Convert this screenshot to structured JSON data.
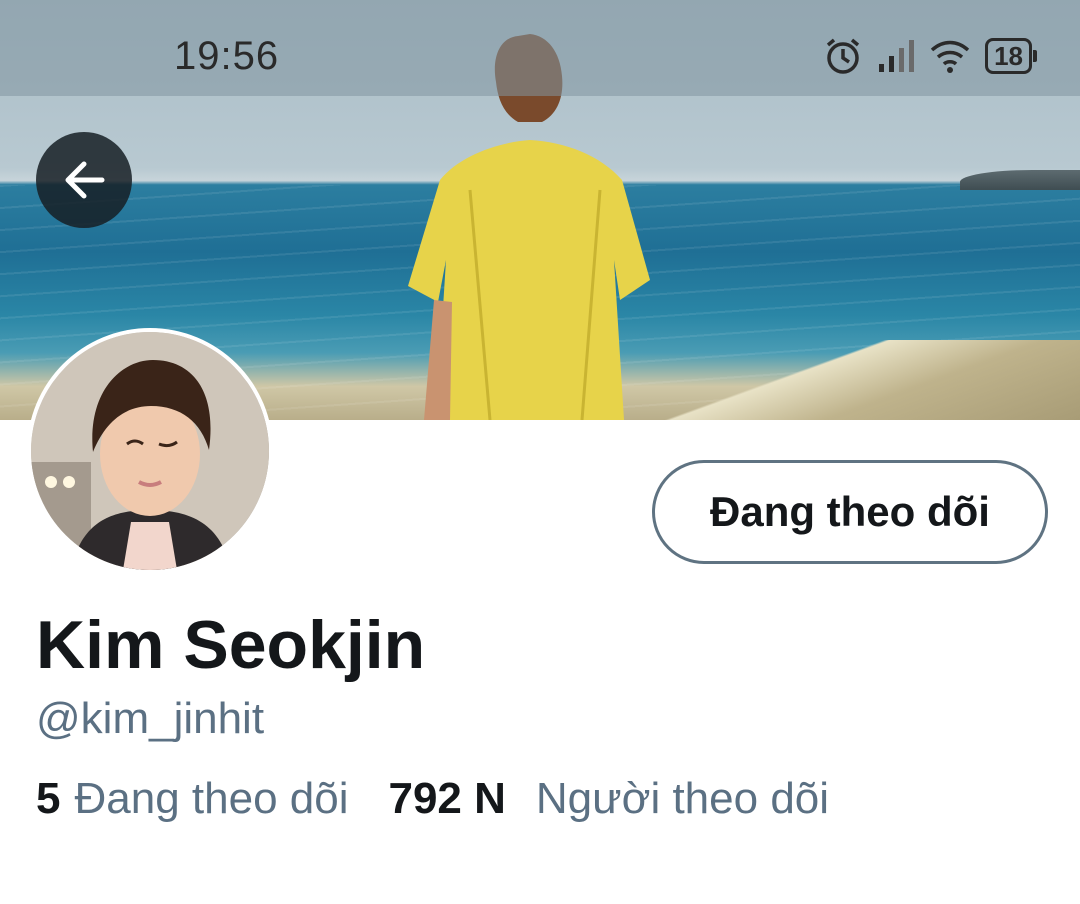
{
  "status_bar": {
    "time": "19:56",
    "battery": "18",
    "icons": [
      "alarm-icon",
      "signal-icon",
      "wifi-icon",
      "battery-icon"
    ]
  },
  "header": {
    "back_icon": "arrow-left-icon"
  },
  "profile": {
    "name": "Kim Seokjin",
    "handle": "@kim_jinhit",
    "follow_button_label": "Đang theo dõi",
    "following_count": "5",
    "following_label": "Đang theo dõi",
    "followers_count": "792 N",
    "followers_label": "Người theo dõi"
  },
  "colors": {
    "text_primary": "#14171a",
    "text_secondary": "#5b7083",
    "button_border": "#5f7382",
    "back_button_bg": "#161e24"
  }
}
